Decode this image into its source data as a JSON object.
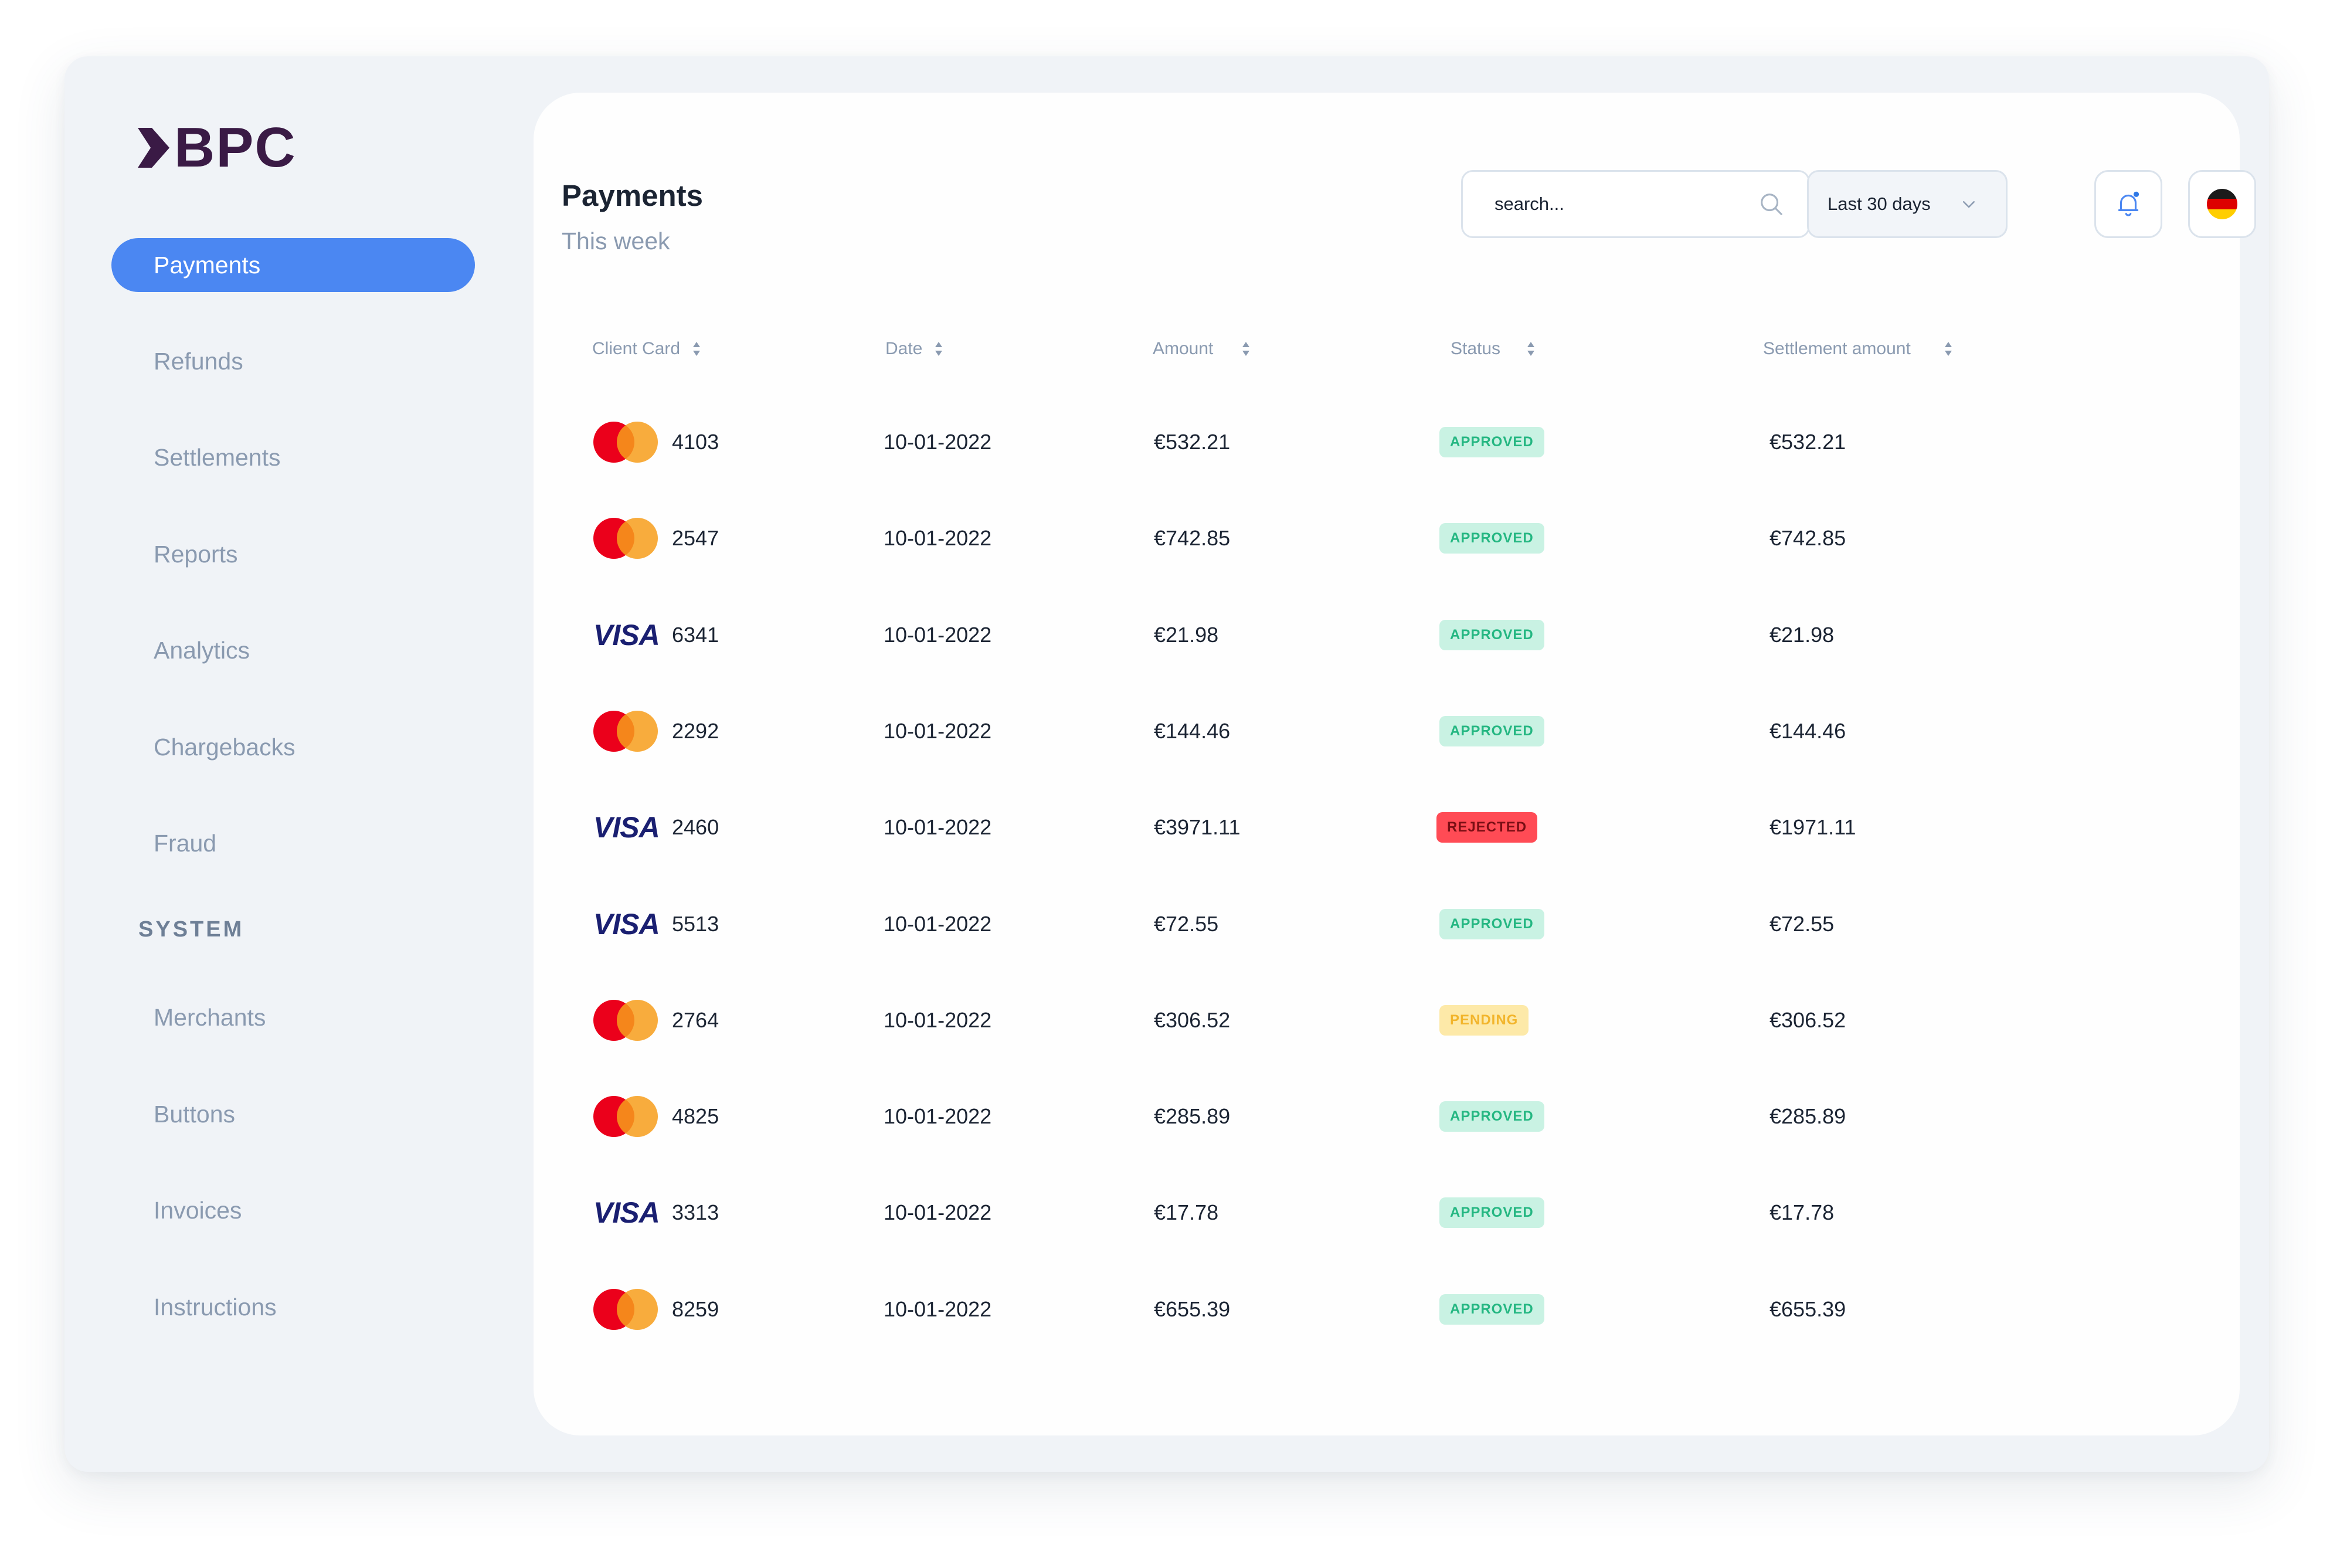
{
  "brand": {
    "name": "BPC"
  },
  "sidebar": {
    "items": [
      {
        "label": "Payments",
        "active": true
      },
      {
        "label": "Refunds"
      },
      {
        "label": "Settlements"
      },
      {
        "label": "Reports"
      },
      {
        "label": "Analytics"
      },
      {
        "label": "Chargebacks"
      },
      {
        "label": "Fraud"
      }
    ],
    "section_label": "SYSTEM",
    "system_items": [
      {
        "label": "Merchants"
      },
      {
        "label": "Buttons"
      },
      {
        "label": "Invoices"
      },
      {
        "label": "Instructions"
      }
    ]
  },
  "header": {
    "title": "Payments",
    "subtitle": "This week",
    "search_placeholder": "search...",
    "date_range": "Last 30 days",
    "language_flag": "germany-flag-icon"
  },
  "table": {
    "columns": [
      "Client Card",
      "Date",
      "Amount",
      "Status",
      "Settlement amount"
    ],
    "rows": [
      {
        "brand": "mastercard",
        "card": "4103",
        "date": "10-01-2022",
        "amount": "€532.21",
        "status": "APPROVED",
        "settlement": "€532.21"
      },
      {
        "brand": "mastercard",
        "card": "2547",
        "date": "10-01-2022",
        "amount": "€742.85",
        "status": "APPROVED",
        "settlement": "€742.85"
      },
      {
        "brand": "visa",
        "card": "6341",
        "date": "10-01-2022",
        "amount": "€21.98",
        "status": "APPROVED",
        "settlement": "€21.98"
      },
      {
        "brand": "mastercard",
        "card": "2292",
        "date": "10-01-2022",
        "amount": "€144.46",
        "status": "APPROVED",
        "settlement": "€144.46"
      },
      {
        "brand": "visa",
        "card": "2460",
        "date": "10-01-2022",
        "amount": "€3971.11",
        "status": "REJECTED",
        "settlement": "€1971.11"
      },
      {
        "brand": "visa",
        "card": "5513",
        "date": "10-01-2022",
        "amount": "€72.55",
        "status": "APPROVED",
        "settlement": "€72.55"
      },
      {
        "brand": "mastercard",
        "card": "2764",
        "date": "10-01-2022",
        "amount": "€306.52",
        "status": "PENDING",
        "settlement": "€306.52"
      },
      {
        "brand": "mastercard",
        "card": "4825",
        "date": "10-01-2022",
        "amount": "€285.89",
        "status": "APPROVED",
        "settlement": "€285.89"
      },
      {
        "brand": "visa",
        "card": "3313",
        "date": "10-01-2022",
        "amount": "€17.78",
        "status": "APPROVED",
        "settlement": "€17.78"
      },
      {
        "brand": "mastercard",
        "card": "8259",
        "date": "10-01-2022",
        "amount": "€655.39",
        "status": "APPROVED",
        "settlement": "€655.39"
      }
    ],
    "visa_label": "VISA"
  },
  "colors": {
    "accent": "#4b87f2",
    "brand_logo": "#3a1a45",
    "approved_bg": "#c9f2e3",
    "approved_text": "#25b782",
    "rejected_bg": "#ff4b55",
    "pending_bg": "#fde9a8",
    "pending_text": "#f2b52c"
  }
}
